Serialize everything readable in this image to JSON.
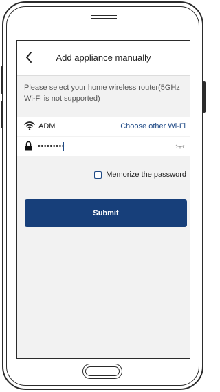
{
  "header": {
    "title": "Add appliance manually",
    "back_icon": "chevron-left-icon"
  },
  "instruction": "Please select your home wireless router(5GHz Wi-Fi is not supported)",
  "wifi": {
    "icon": "wifi-icon",
    "ssid": "ADM",
    "choose_other_label": "Choose other Wi-Fi"
  },
  "password": {
    "icon": "lock-icon",
    "value": "•••••••••",
    "visibility_icon": "eye-closed-icon"
  },
  "remember": {
    "label": "Memorize the password",
    "checked": false
  },
  "submit_label": "Submit",
  "colors": {
    "accent": "#173f7a",
    "link": "#1f4a86",
    "screen_background": "#f2f2f2"
  }
}
